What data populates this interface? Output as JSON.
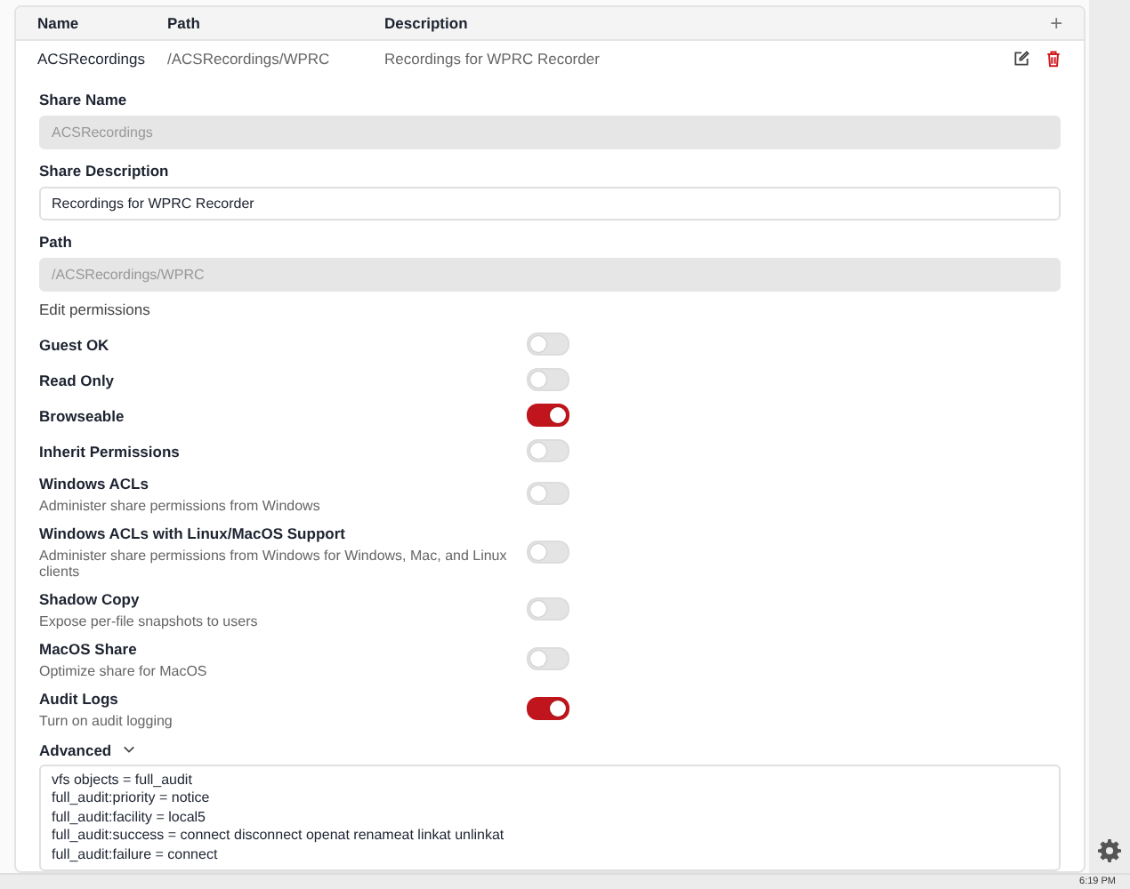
{
  "table": {
    "columns": [
      "Name",
      "Path",
      "Description"
    ],
    "add_symbol": "+",
    "rows": [
      {
        "name": "ACSRecordings",
        "path": "/ACSRecordings/WPRC",
        "description": "Recordings for WPRC Recorder"
      }
    ]
  },
  "form": {
    "fields": [
      {
        "label": "Share Name",
        "value": "ACSRecordings",
        "disabled": true
      },
      {
        "label": "Share Description",
        "value": "Recordings for WPRC Recorder",
        "disabled": false
      },
      {
        "label": "Path",
        "value": "/ACSRecordings/WPRC",
        "disabled": true
      }
    ],
    "edit_permissions": "Edit permissions",
    "toggles": [
      {
        "label": "Guest OK",
        "on": false
      },
      {
        "label": "Read Only",
        "on": false
      },
      {
        "label": "Browseable",
        "on": true
      },
      {
        "label": "Inherit Permissions",
        "on": false
      },
      {
        "label": "Windows ACLs",
        "description": "Administer share permissions from Windows",
        "on": false
      },
      {
        "label": "Windows ACLs with Linux/MacOS Support",
        "description": "Administer share permissions from Windows for Windows, Mac, and Linux clients",
        "on": false
      },
      {
        "label": "Shadow Copy",
        "description": "Expose per-file snapshots to users",
        "on": false
      },
      {
        "label": "MacOS Share",
        "description": "Optimize share for MacOS",
        "on": false
      },
      {
        "label": "Audit Logs",
        "description": "Turn on audit logging",
        "on": true
      }
    ],
    "advanced": {
      "label": "Advanced",
      "expanded": true,
      "lines": [
        "vfs objects = full_audit",
        "full_audit:priority = notice",
        "full_audit:facility = local5",
        "full_audit:success = connect disconnect openat renameat linkat unlinkat",
        "full_audit:failure = connect"
      ]
    }
  },
  "taskbar": {
    "time": "6:19 PM"
  }
}
